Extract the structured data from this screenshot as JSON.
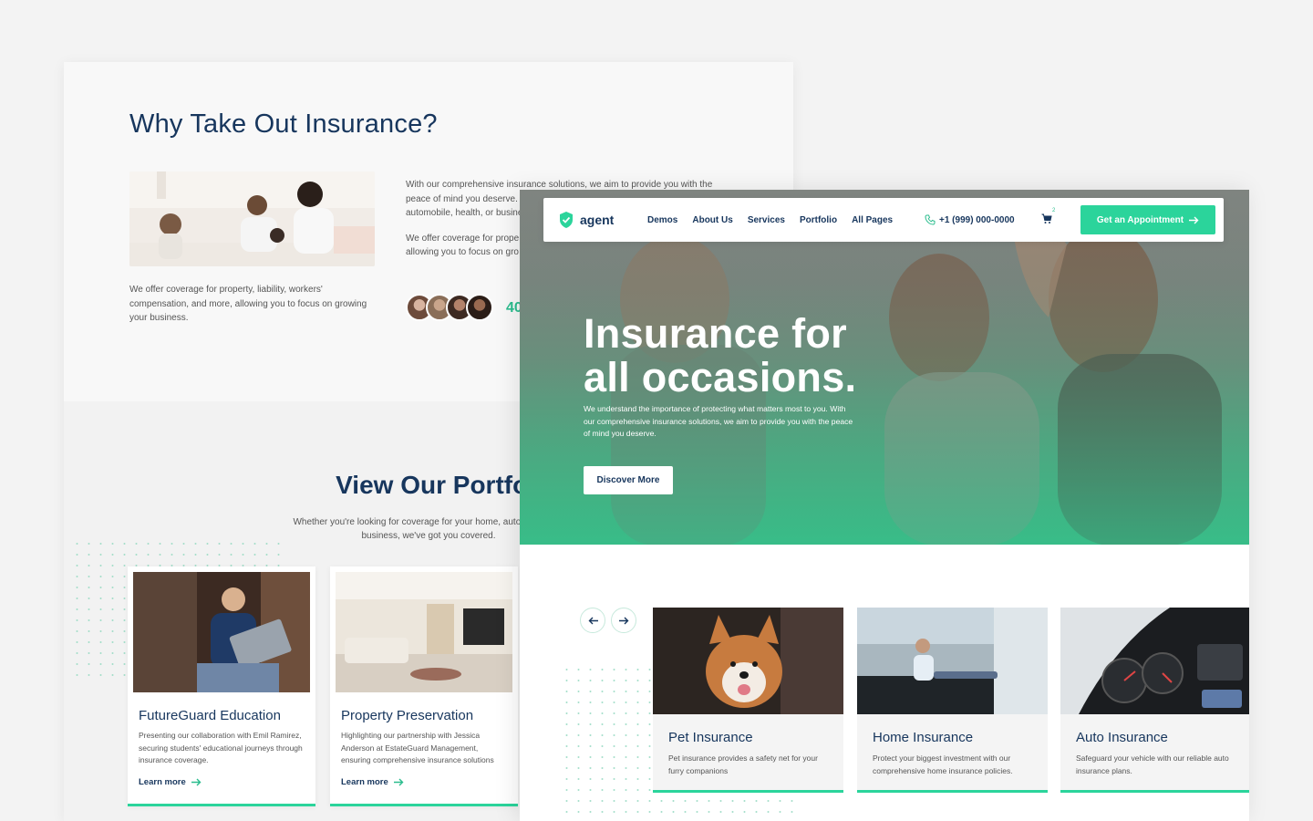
{
  "colors": {
    "accent": "#2bd49b",
    "navy": "#17365d",
    "background": "#f3f3f3"
  },
  "back_page": {
    "why_section": {
      "title": "Why Take Out Insurance?",
      "image_alt": "family-photo",
      "left_text": "We offer coverage for property, liability, workers' compensation, and more, allowing you to focus on growing your business.",
      "right_text_1": "With our comprehensive insurance solutions, we aim to provide you with the peace of mind you deserve. ... automobile, health, or busine",
      "right_text_1_lines": [
        "With our comprehensive insurance solutions, we aim to provide you with the",
        "peace of mind you deserve.",
        "automobile, health, or busine"
      ],
      "right_text_2_lines": [
        "We offer coverage for prope",
        "allowing you to focus on gro"
      ],
      "stat_number": "40"
    },
    "portfolio_section": {
      "title": "View Our Portfolio",
      "subtitle": "Whether you're looking for coverage for your home, auto, health, or business, we've got you covered.",
      "cards": [
        {
          "title": "FutureGuard Education",
          "description": "Presenting our collaboration with Emil Ramirez, securing students' educational journeys through insurance coverage.",
          "link": "Learn more"
        },
        {
          "title": "Property Preservation",
          "description": "Highlighting our partnership with Jessica Anderson at EstateGuard Management, ensuring comprehensive insurance solutions",
          "link": "Learn more"
        }
      ]
    }
  },
  "front_page": {
    "navbar": {
      "logo_text": "agent",
      "items": [
        "Demos",
        "About Us",
        "Services",
        "Portfolio",
        "All Pages"
      ],
      "phone": "+1 (999) 000-0000",
      "cart_count": "2",
      "cta_label": "Get an Appointment"
    },
    "hero": {
      "title": "Insurance for all occasions.",
      "description": "We understand the importance of protecting what matters most to you. With our comprehensive insurance solutions, we aim to provide you with the peace of mind you deserve.",
      "button_label": "Discover More"
    },
    "services": [
      {
        "title": "Pet Insurance",
        "description": "Pet insurance provides a safety net for your furry companions"
      },
      {
        "title": "Home Insurance",
        "description": "Protect your biggest investment with our comprehensive home insurance policies."
      },
      {
        "title": "Auto Insurance",
        "description": "Safeguard your vehicle with our reliable auto insurance plans."
      }
    ],
    "icons": {
      "logo": "shield-check-icon",
      "phone": "phone-icon",
      "cart": "cart-icon",
      "cta_arrow": "arrow-right-icon",
      "prev": "arrow-left-icon",
      "next": "arrow-right-icon"
    }
  }
}
